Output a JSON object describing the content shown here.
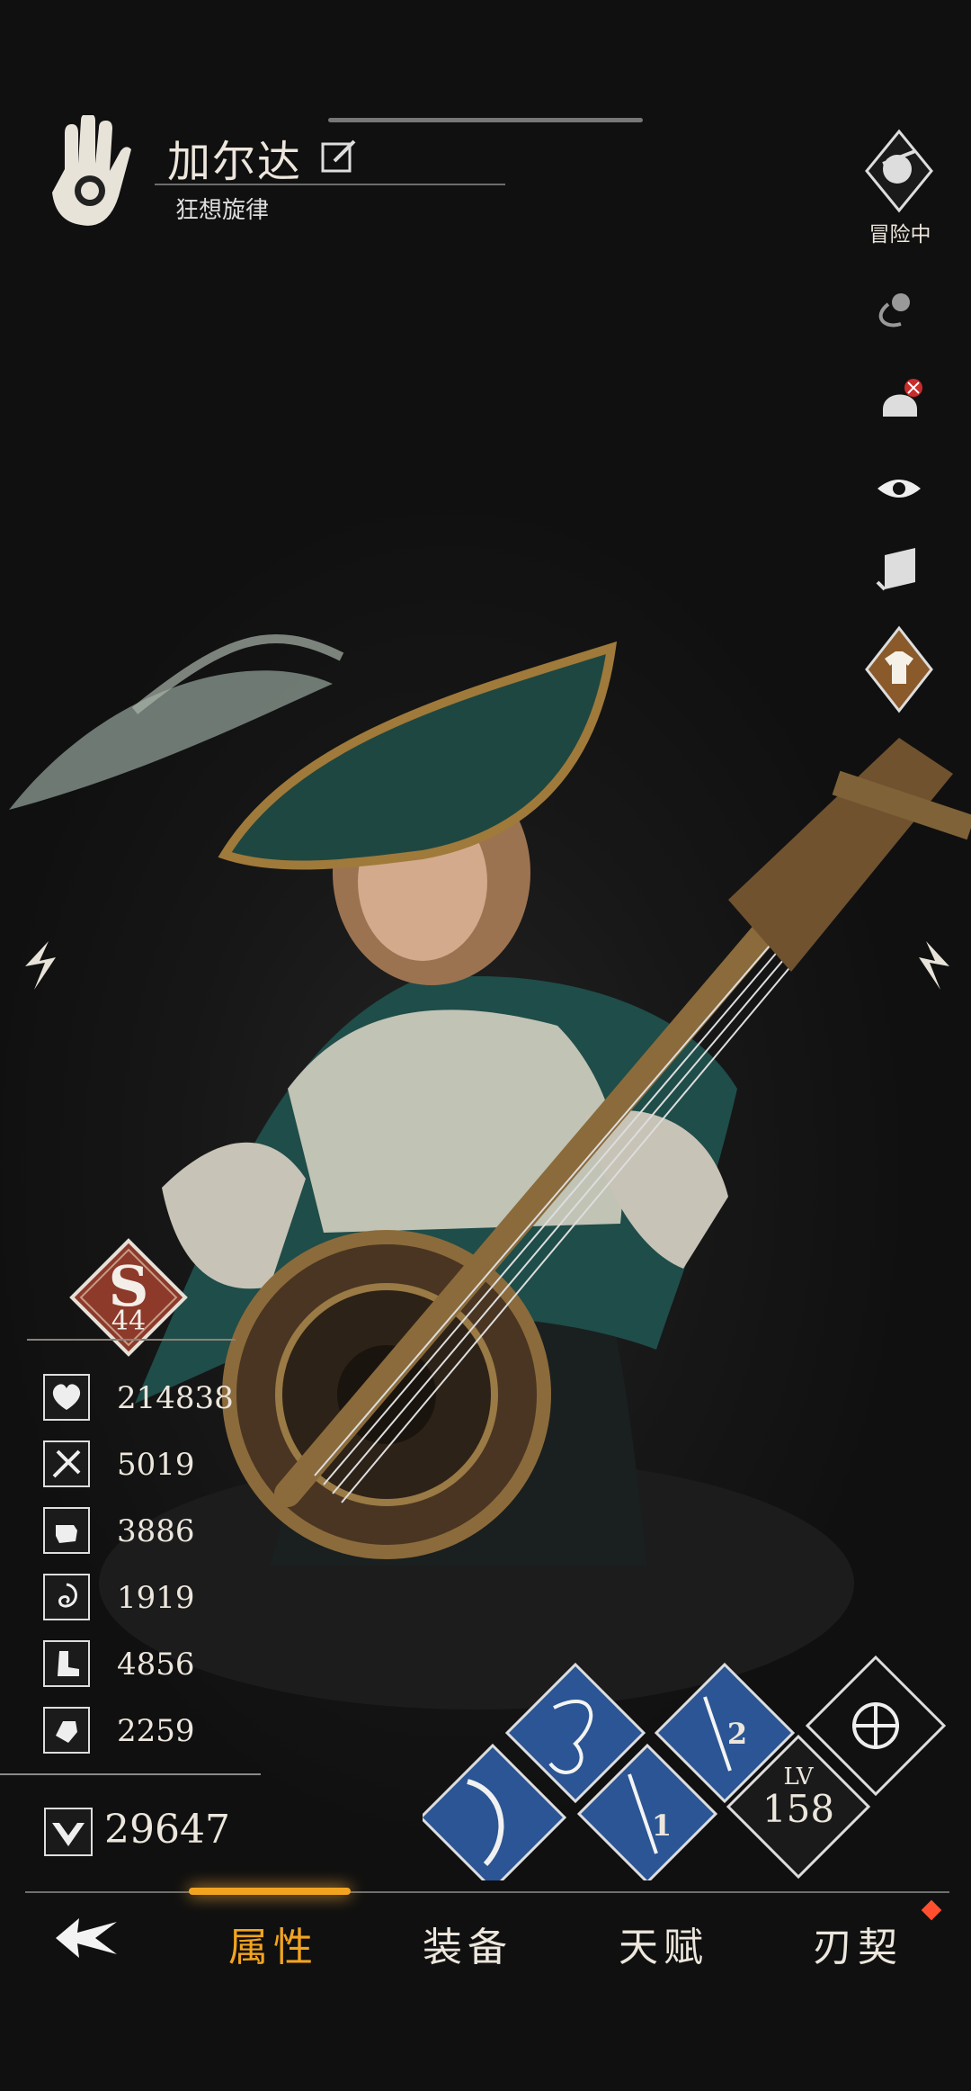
{
  "character": {
    "name": "加尔达",
    "class_name": "狂想旋律"
  },
  "status": {
    "label": "冒险中"
  },
  "rank": {
    "letter": "S",
    "level": "44"
  },
  "stats": [
    {
      "icon": "heart-icon",
      "value": "214838"
    },
    {
      "icon": "sword-icon",
      "value": "5019"
    },
    {
      "icon": "fist-icon",
      "value": "3886"
    },
    {
      "icon": "swirl-icon",
      "value": "1919"
    },
    {
      "icon": "boot-icon",
      "value": "4856"
    },
    {
      "icon": "hand-heart-icon",
      "value": "2259"
    }
  ],
  "power": {
    "value": "29647"
  },
  "skills": {
    "lv_label": "LV",
    "lv_value": "158",
    "slot_1": "1",
    "slot_2": "2"
  },
  "tabs": [
    {
      "label": "属性",
      "active": true
    },
    {
      "label": "装备",
      "active": false
    },
    {
      "label": "天赋",
      "active": false
    },
    {
      "label": "刃契",
      "active": false
    }
  ],
  "colors": {
    "active_tab": "#f2a421",
    "rank_badge": "#8d3a2b",
    "skill_blue": "#274e8f",
    "notification": "#ff4f2f"
  }
}
